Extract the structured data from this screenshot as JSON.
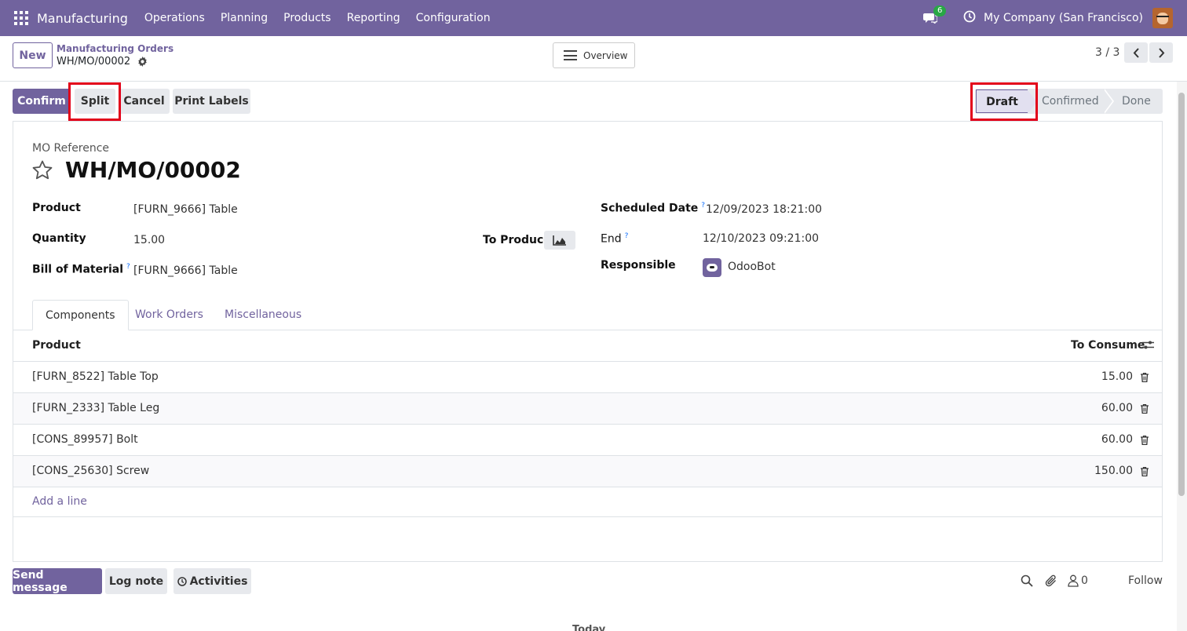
{
  "navbar": {
    "brand": "Manufacturing",
    "menu": [
      "Operations",
      "Planning",
      "Products",
      "Reporting",
      "Configuration"
    ],
    "messages_badge": "6",
    "company": "My Company (San Francisco)"
  },
  "control": {
    "new_label": "New",
    "breadcrumb_parent": "Manufacturing Orders",
    "breadcrumb_current": "WH/MO/00002",
    "overview_label": "Overview",
    "pager": "3 / 3"
  },
  "actions": {
    "confirm": "Confirm",
    "split": "Split",
    "cancel": "Cancel",
    "print_labels": "Print Labels"
  },
  "status": {
    "stages": [
      "Draft",
      "Confirmed",
      "Done"
    ],
    "current": "Draft"
  },
  "form": {
    "ref_label": "MO Reference",
    "title": "WH/MO/00002",
    "product_label": "Product",
    "product_value": "[FURN_9666] Table",
    "quantity_label": "Quantity",
    "quantity_value": "15.00",
    "bom_label": "Bill of Material",
    "bom_value": "[FURN_9666] Table",
    "to_produce_label": "To Produce",
    "scheduled_label": "Scheduled Date",
    "scheduled_value": "12/09/2023 18:21:00",
    "end_label": "End",
    "end_value": "12/10/2023 09:21:00",
    "responsible_label": "Responsible",
    "responsible_value": "OdooBot",
    "help_mark": "?"
  },
  "tabs": [
    "Components",
    "Work Orders",
    "Miscellaneous"
  ],
  "components": {
    "headers": [
      "Product",
      "To Consume"
    ],
    "rows": [
      {
        "product": "[FURN_8522] Table Top",
        "qty": "15.00"
      },
      {
        "product": "[FURN_2333] Table Leg",
        "qty": "60.00"
      },
      {
        "product": "[CONS_89957] Bolt",
        "qty": "60.00"
      },
      {
        "product": "[CONS_25630] Screw",
        "qty": "150.00"
      }
    ],
    "add_line": "Add a line"
  },
  "chatter": {
    "send_message": "Send message",
    "log_note": "Log note",
    "activities": "Activities",
    "followers_count": "0",
    "follow": "Follow",
    "today": "Today"
  },
  "colors": {
    "brand": "#71639e",
    "highlight": "#e2001a"
  }
}
